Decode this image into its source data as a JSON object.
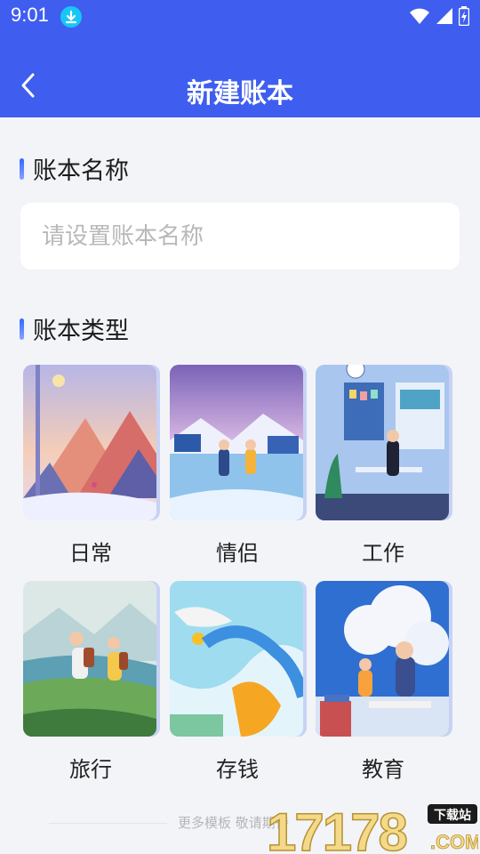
{
  "status_bar": {
    "time": "9:01"
  },
  "app_bar": {
    "title": "新建账本"
  },
  "name_section": {
    "title": "账本名称",
    "input_placeholder": "请设置账本名称",
    "input_value": ""
  },
  "type_section": {
    "title": "账本类型",
    "types": [
      {
        "label": "日常",
        "icon": "mountain-illustration"
      },
      {
        "label": "情侣",
        "icon": "skating-couple-illustration"
      },
      {
        "label": "工作",
        "icon": "office-illustration"
      },
      {
        "label": "旅行",
        "icon": "hiking-illustration"
      },
      {
        "label": "存钱",
        "icon": "savings-illustration"
      },
      {
        "label": "教育",
        "icon": "study-illustration"
      }
    ]
  },
  "footer": {
    "text": "更多模板 敬请期待"
  },
  "watermark": {
    "text": "17178",
    "badge": "下载站",
    "suffix": ".COM"
  },
  "colors": {
    "primary": "#3f5ef0",
    "background": "#f3f4f8"
  }
}
